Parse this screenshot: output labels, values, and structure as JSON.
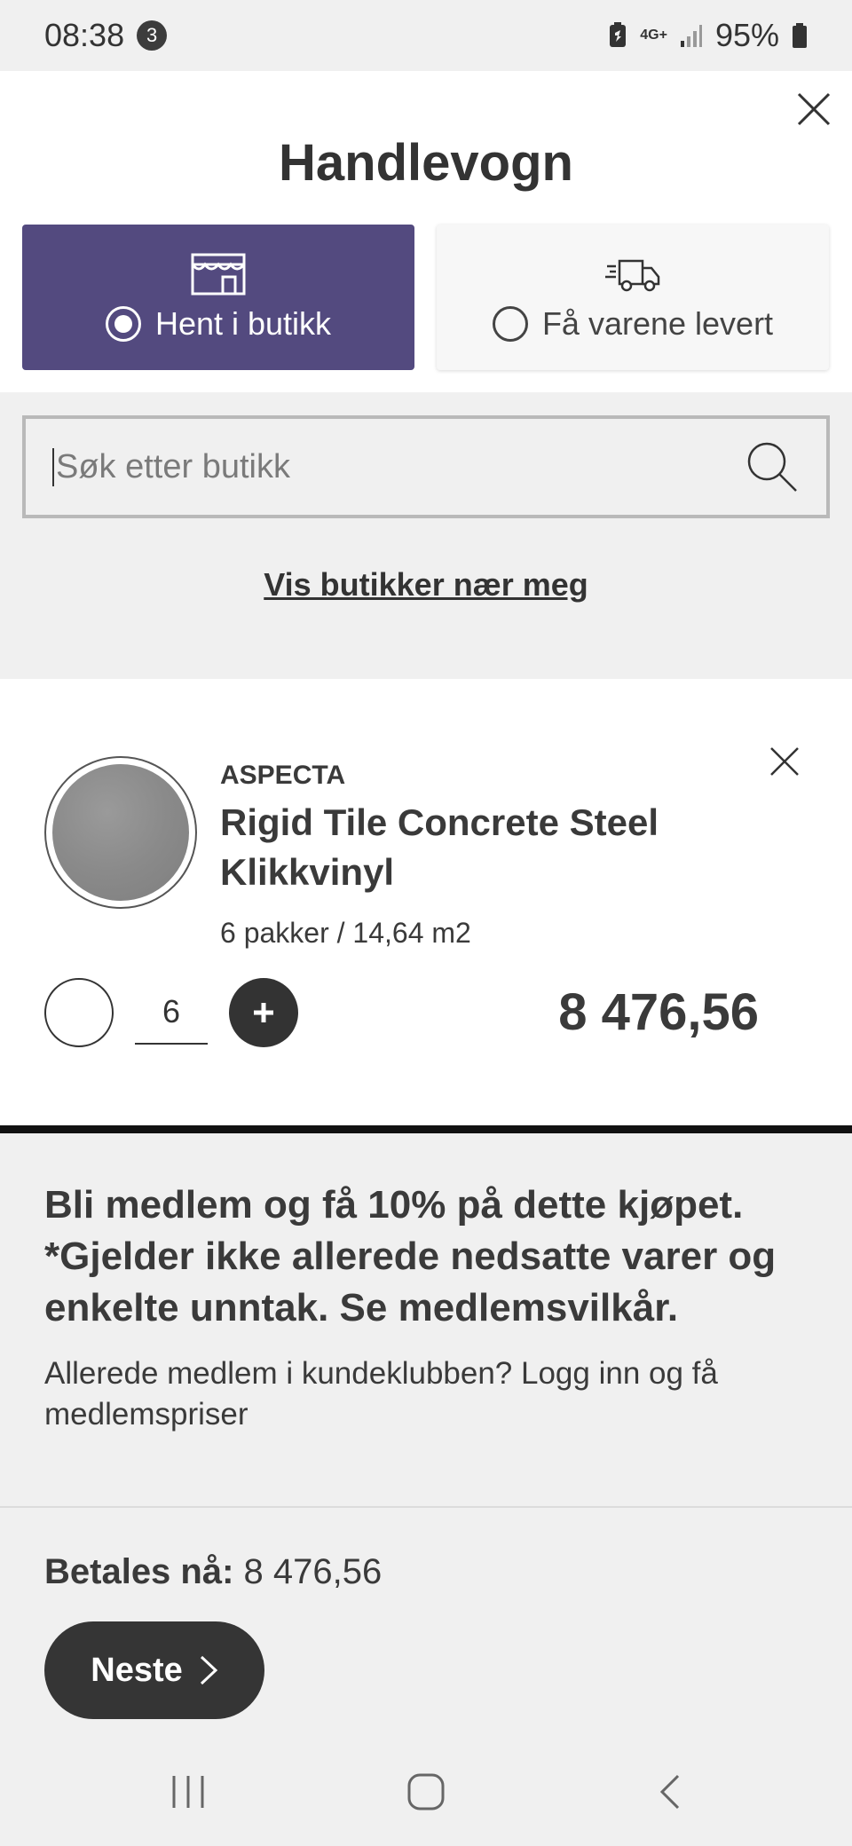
{
  "status_bar": {
    "time": "08:38",
    "notification_count": "3",
    "network": "4G+",
    "battery": "95%"
  },
  "header": {
    "title": "Handlevogn"
  },
  "delivery_options": [
    {
      "label": "Hent i butikk",
      "icon": "store-icon",
      "selected": true
    },
    {
      "label": "Få varene levert",
      "icon": "truck-icon",
      "selected": false
    }
  ],
  "store_search": {
    "placeholder": "Søk etter butikk",
    "value": "",
    "near_me_link": "Vis butikker nær meg"
  },
  "cart_item": {
    "brand": "ASPECTA",
    "name": "Rigid Tile Concrete Steel Klikkvinyl",
    "quantity_desc": "6 pakker / 14,64 m2",
    "quantity": "6",
    "price": "8 476,56"
  },
  "membership": {
    "headline": "Bli medlem og få 10% på dette kjøpet. *Gjelder ikke allerede nedsatte varer og enkelte unntak. Se medlemsvilkår.",
    "login_text": "Allerede medlem i kundeklubben? Logg inn og få medlemspriser"
  },
  "footer": {
    "pay_label": "Betales nå:",
    "pay_amount": "8 476,56",
    "next_label": "Neste"
  },
  "colors": {
    "accent": "#534a7f",
    "dark_button": "#353535",
    "background": "#f0f0f0"
  }
}
